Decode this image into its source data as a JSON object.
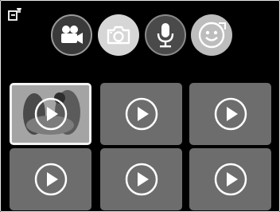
{
  "toolbar": {
    "status_icon": "gallery-settings-icon",
    "modes": [
      {
        "name": "video",
        "icon": "video-camera-icon",
        "active": true
      },
      {
        "name": "photo",
        "icon": "camera-icon",
        "active": false
      },
      {
        "name": "audio",
        "icon": "microphone-icon",
        "active": false
      },
      {
        "name": "face",
        "icon": "smiley-face-icon",
        "active": false
      }
    ]
  },
  "gallery": {
    "items": [
      {
        "kind": "video",
        "icon": "play-icon",
        "selected": true,
        "has_preview": true
      },
      {
        "kind": "video",
        "icon": "play-icon",
        "selected": false,
        "has_preview": false
      },
      {
        "kind": "video",
        "icon": "play-icon",
        "selected": false,
        "has_preview": false
      },
      {
        "kind": "video",
        "icon": "play-icon",
        "selected": false,
        "has_preview": false
      },
      {
        "kind": "video",
        "icon": "play-icon",
        "selected": false,
        "has_preview": false
      },
      {
        "kind": "video",
        "icon": "play-icon",
        "selected": false,
        "has_preview": false
      }
    ]
  },
  "colors": {
    "background": "#000000",
    "tile": "#6d6d6d",
    "selected_border": "#f4f4f4",
    "icon_white": "#ffffff"
  }
}
